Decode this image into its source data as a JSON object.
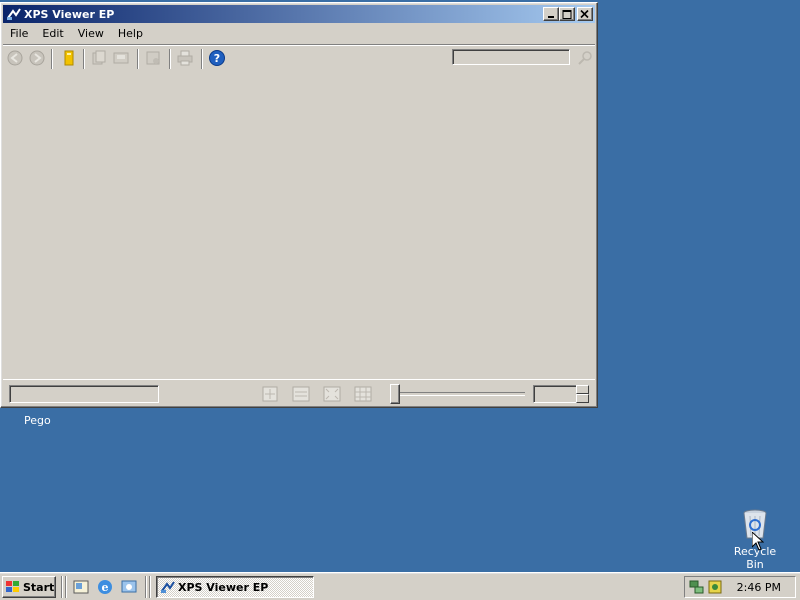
{
  "window": {
    "title": "XPS Viewer EP",
    "menu": [
      "File",
      "Edit",
      "View",
      "Help"
    ],
    "search_placeholder": ""
  },
  "desktop": {
    "items": [
      {
        "label": "Pego"
      },
      {
        "label": "Recycle Bin",
        "icon": "recycle-bin-icon"
      }
    ]
  },
  "taskbar": {
    "start_label": "Start",
    "task_label": "XPS Viewer EP",
    "clock": "2:46 PM"
  },
  "colors": {
    "desktop": "#3a6ea5",
    "titlebar_start": "#0a246a",
    "titlebar_end": "#a6caf0",
    "face": "#d4d0c8"
  }
}
